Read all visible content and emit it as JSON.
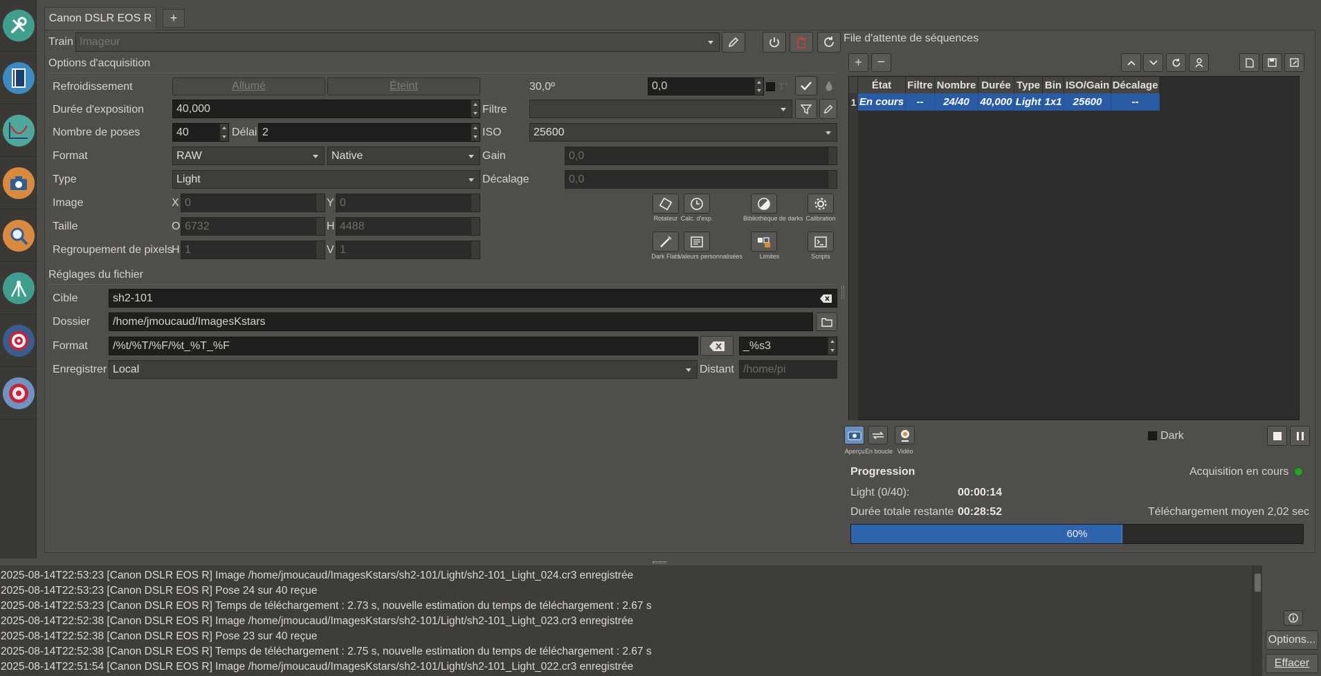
{
  "colors": {
    "accent_blue": "#2a5ca6",
    "progress_fill": "#2e63ad",
    "status_green": "#27a02b",
    "stop_red": "#c0443a"
  },
  "sidebar": {
    "items": [
      {
        "icon": "wrench-screwdriver-icon"
      },
      {
        "icon": "book-icon"
      },
      {
        "icon": "focus-graph-icon"
      },
      {
        "icon": "camera-icon"
      },
      {
        "icon": "magnifier-icon"
      },
      {
        "icon": "mount-tripod-icon"
      },
      {
        "icon": "target-icon"
      },
      {
        "icon": "guide-target-icon"
      }
    ]
  },
  "tabs": {
    "active": "Canon DSLR EOS R",
    "add": "+"
  },
  "train": {
    "label": "Train",
    "placeholder": "Imageur"
  },
  "acq": {
    "title": "Options d'acquisition",
    "cooling_label": "Refroidissement",
    "cooling_on": "Allumé",
    "cooling_off": "Éteint",
    "temp_value": "30,0º",
    "temp_target": "0,0",
    "temp_unit": "T°",
    "exposure_label": "Durée d'exposition",
    "exposure_value": "40,000",
    "filter_label": "Filtre",
    "count_label": "Nombre de poses",
    "count_value": "40",
    "delay_label": "Délai",
    "delay_value": "2",
    "iso_label": "ISO",
    "iso_value": "25600",
    "format_label": "Format",
    "format_value": "RAW",
    "encoding_value": "Native",
    "gain_label": "Gain",
    "gain_value": "0,0",
    "type_label": "Type",
    "type_value": "Light",
    "offset_label": "Décalage",
    "offset_value": "0,0",
    "image_label": "Image",
    "x_label": "X",
    "x_value": "0",
    "y_label": "Y",
    "y_value": "0",
    "size_label": "Taille",
    "w_label": "O",
    "w_value": "6732",
    "h_label": "H",
    "h_value": "4488",
    "bin_label": "Regroupement de pixels",
    "binh_label": "H",
    "binh_value": "1",
    "binv_label": "V",
    "binv_value": "1",
    "tools": {
      "rotator": "Rotateur",
      "calc": "Calc. d'exp.",
      "darklib": "Bibliothèque de darks",
      "calibration": "Calibration",
      "darkflats": "Dark Flats",
      "custom": "Valeurs personnalisées",
      "limits": "Limites",
      "scripts": "Scripts"
    }
  },
  "file": {
    "title": "Réglages du fichier",
    "target_label": "Cible",
    "target_value": "sh2-101",
    "dir_label": "Dossier",
    "dir_value": "/home/jmoucaud/ImagesKstars",
    "format_label": "Format",
    "format_value": "/%t/%T/%F/%t_%T_%F",
    "suffix_value": "_%s3",
    "save_label": "Enregistrer",
    "save_value": "Local",
    "remote_label": "Distant",
    "remote_placeholder": "/home/pi"
  },
  "queue": {
    "title": "File d'attente de séquences",
    "columns": [
      "État",
      "Filtre",
      "Nombre",
      "Durée",
      "Type",
      "Bin",
      "ISO/Gain",
      "Décalage"
    ],
    "rows": [
      {
        "index": "1",
        "cells": [
          "En cours",
          "--",
          "24/40",
          "40,000",
          "Light",
          "1x1",
          "25600",
          "--"
        ]
      }
    ],
    "dark_label": "Dark",
    "preview_label": "Aperçu",
    "loop_label": "En boucle",
    "video_label": "Vidéo"
  },
  "progress": {
    "title": "Progression",
    "status": "Acquisition en cours",
    "light_label": "Light (0/40):",
    "light_time": "00:00:14",
    "remaining_label": "Durée totale restante",
    "remaining_time": "00:28:52",
    "download_label": "Téléchargement moyen 2,02 sec",
    "percent": 60,
    "percent_text": "60%"
  },
  "log": {
    "lines": [
      "2025-08-14T22:53:23 [Canon DSLR EOS R] Image /home/jmoucaud/ImagesKstars/sh2-101/Light/sh2-101_Light_024.cr3 enregistrée",
      "2025-08-14T22:53:23 [Canon DSLR EOS R] Pose 24 sur 40 reçue",
      "2025-08-14T22:53:23 [Canon DSLR EOS R] Temps de téléchargement : 2.73 s, nouvelle estimation du temps de téléchargement : 2.67 s",
      "2025-08-14T22:52:38 [Canon DSLR EOS R] Image /home/jmoucaud/ImagesKstars/sh2-101/Light/sh2-101_Light_023.cr3 enregistrée",
      "2025-08-14T22:52:38 [Canon DSLR EOS R] Pose 23 sur 40 reçue",
      "2025-08-14T22:52:38 [Canon DSLR EOS R] Temps de téléchargement : 2.75 s, nouvelle estimation du temps de téléchargement : 2.67 s",
      "2025-08-14T22:51:54 [Canon DSLR EOS R] Image /home/jmoucaud/ImagesKstars/sh2-101/Light/sh2-101_Light_022.cr3 enregistrée"
    ],
    "options": "Options...",
    "clear": "Effacer"
  }
}
